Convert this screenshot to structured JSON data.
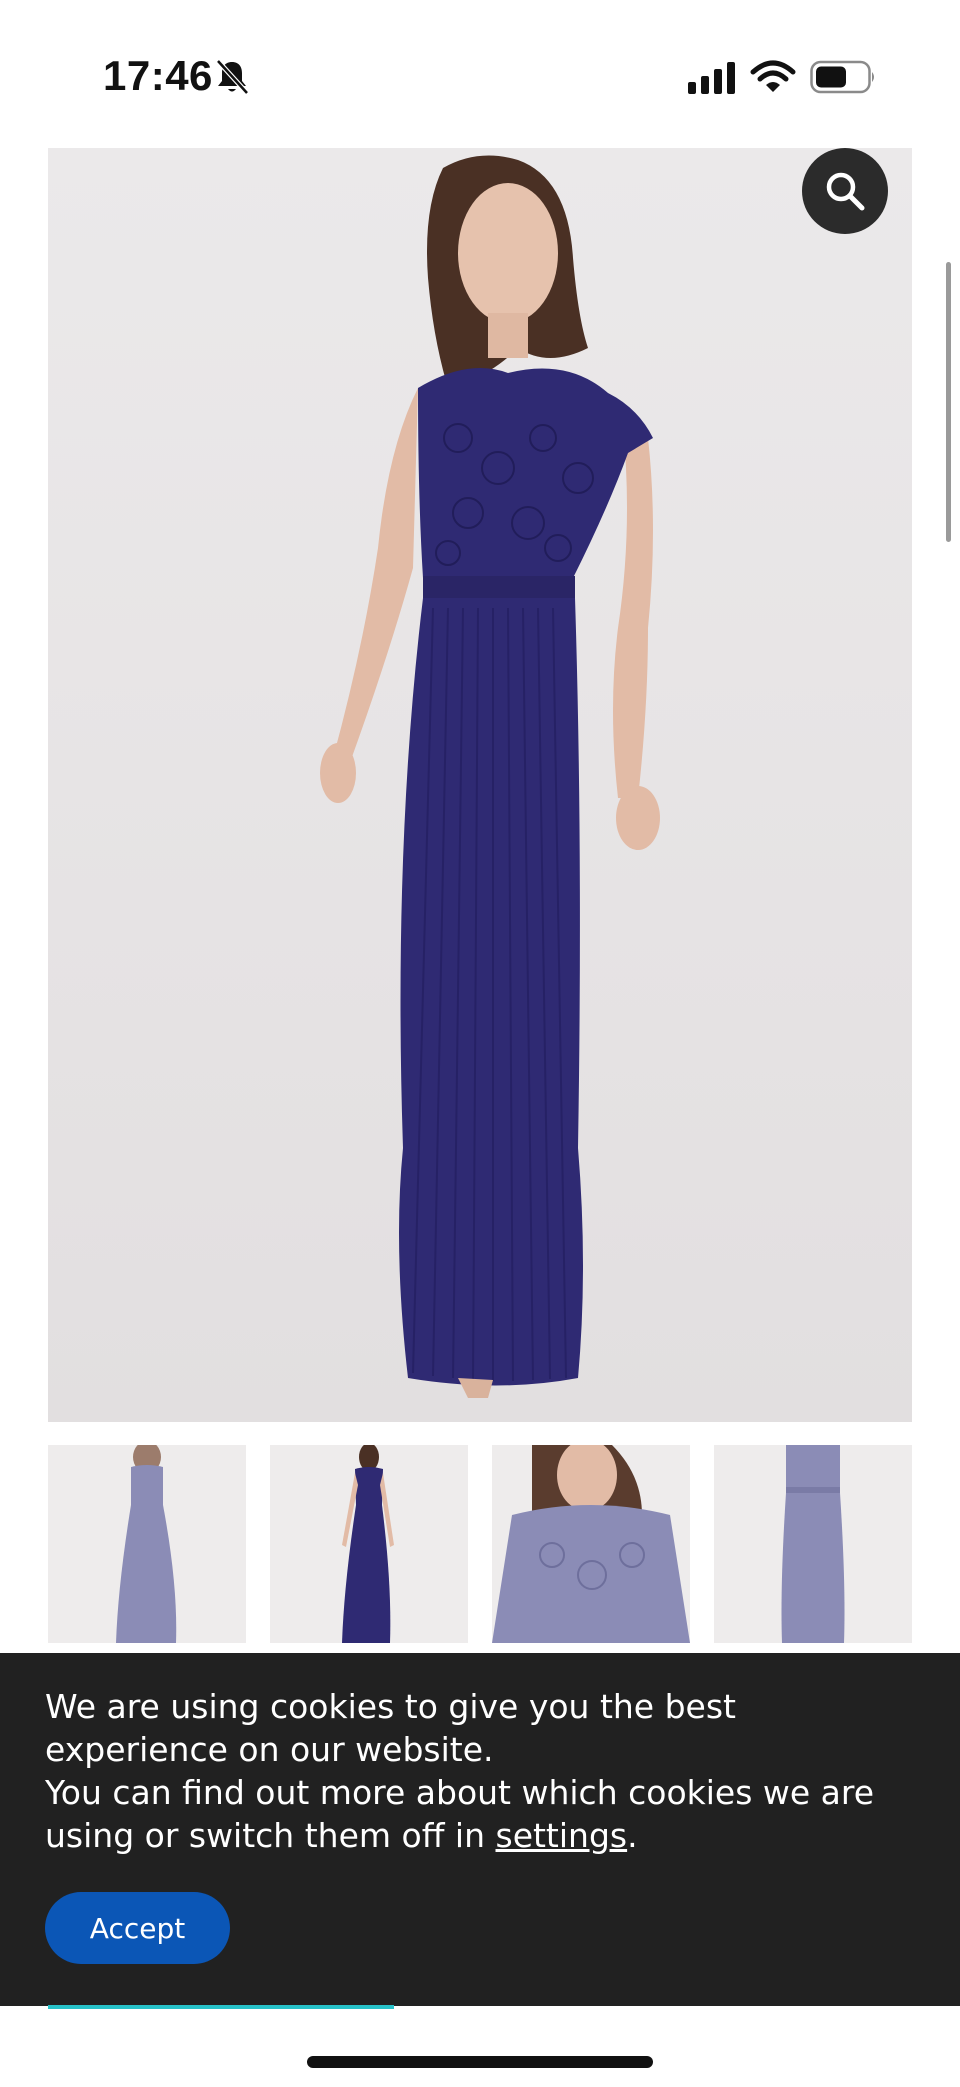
{
  "status_bar": {
    "time": "17:46",
    "icons": [
      "bell-slash-icon",
      "signal-icon",
      "wifi-icon",
      "battery-icon"
    ]
  },
  "product": {
    "main_image": "navy-lace-pleated-maxi-dress-photo",
    "dress_color": "#2f2a73",
    "zoom_icon": "search-icon",
    "thumbnails": [
      {
        "name": "dress-back-view",
        "tone": "#8b8cb6"
      },
      {
        "name": "dress-front-view",
        "tone": "#2f2a73"
      },
      {
        "name": "dress-lace-detail",
        "tone": "#8b8cb6"
      },
      {
        "name": "dress-flat-view",
        "tone": "#8b8cb6"
      }
    ]
  },
  "cookie_banner": {
    "line1": "We are using cookies to give you the best experience on our website.",
    "line2_prefix": "You can find out more about which cookies we are using or switch them off in ",
    "settings_link": "settings",
    "line2_suffix": ".",
    "accept_label": "Accept",
    "background": "#212121",
    "accept_color": "#0b56b6"
  },
  "accent_color": "#27c2c9"
}
